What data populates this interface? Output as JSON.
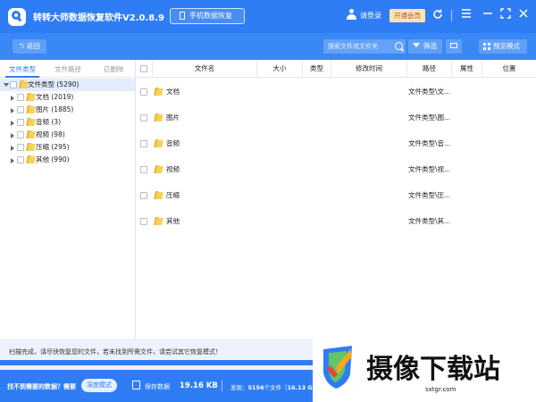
{
  "app": {
    "title": "转转大师数据恢复软件V2.0.8.9",
    "mobile_btn": "手机数据恢复",
    "login": "请登录",
    "vip": "开通会员"
  },
  "toolbar": {
    "back": "返回",
    "search_placeholder": "搜索文件或文件夹",
    "filter": "筛选",
    "preview_mode": "预览模式"
  },
  "sidebar": {
    "tabs": [
      "文件类型",
      "文件路径",
      "已删除"
    ],
    "root": {
      "label": "文件类型 (5290)"
    },
    "items": [
      {
        "label": "文档 (2019)"
      },
      {
        "label": "图片 (1885)"
      },
      {
        "label": "音频 (3)"
      },
      {
        "label": "视频 (98)"
      },
      {
        "label": "压缩 (295)"
      },
      {
        "label": "其他 (990)"
      }
    ]
  },
  "table": {
    "columns": [
      "文件名",
      "大小",
      "类型",
      "修改时间",
      "路径",
      "属性",
      "位置"
    ],
    "rows": [
      {
        "name": "文档",
        "path": "文件类型\\文..."
      },
      {
        "name": "图片",
        "path": "文件类型\\图..."
      },
      {
        "name": "音频",
        "path": "文件类型\\音..."
      },
      {
        "name": "视频",
        "path": "文件类型\\视..."
      },
      {
        "name": "压缩",
        "path": "文件类型\\压..."
      },
      {
        "name": "其他",
        "path": "文件类型\\其..."
      }
    ]
  },
  "status": {
    "scan_message": "扫描完成，请尽快恢复您的文件，若未找到所需文件，请尝试其它恢复模式！",
    "progress": 1.0,
    "not_found": "找不到需要的数据？需要",
    "deep_mode": "深度模式",
    "save_label": "保存数据",
    "save_size": "19.16 KB",
    "found_prefix": "发现：",
    "found_count": "5156",
    "found_mid": "个文件（",
    "found_size": "16.13 G"
  },
  "watermark": {
    "text": "摄像下载站",
    "url": "sxtgr.com"
  },
  "colors": {
    "primary": "#2f7df4",
    "folder": "#f7d25a",
    "vip_bg": "#fde3b9"
  }
}
